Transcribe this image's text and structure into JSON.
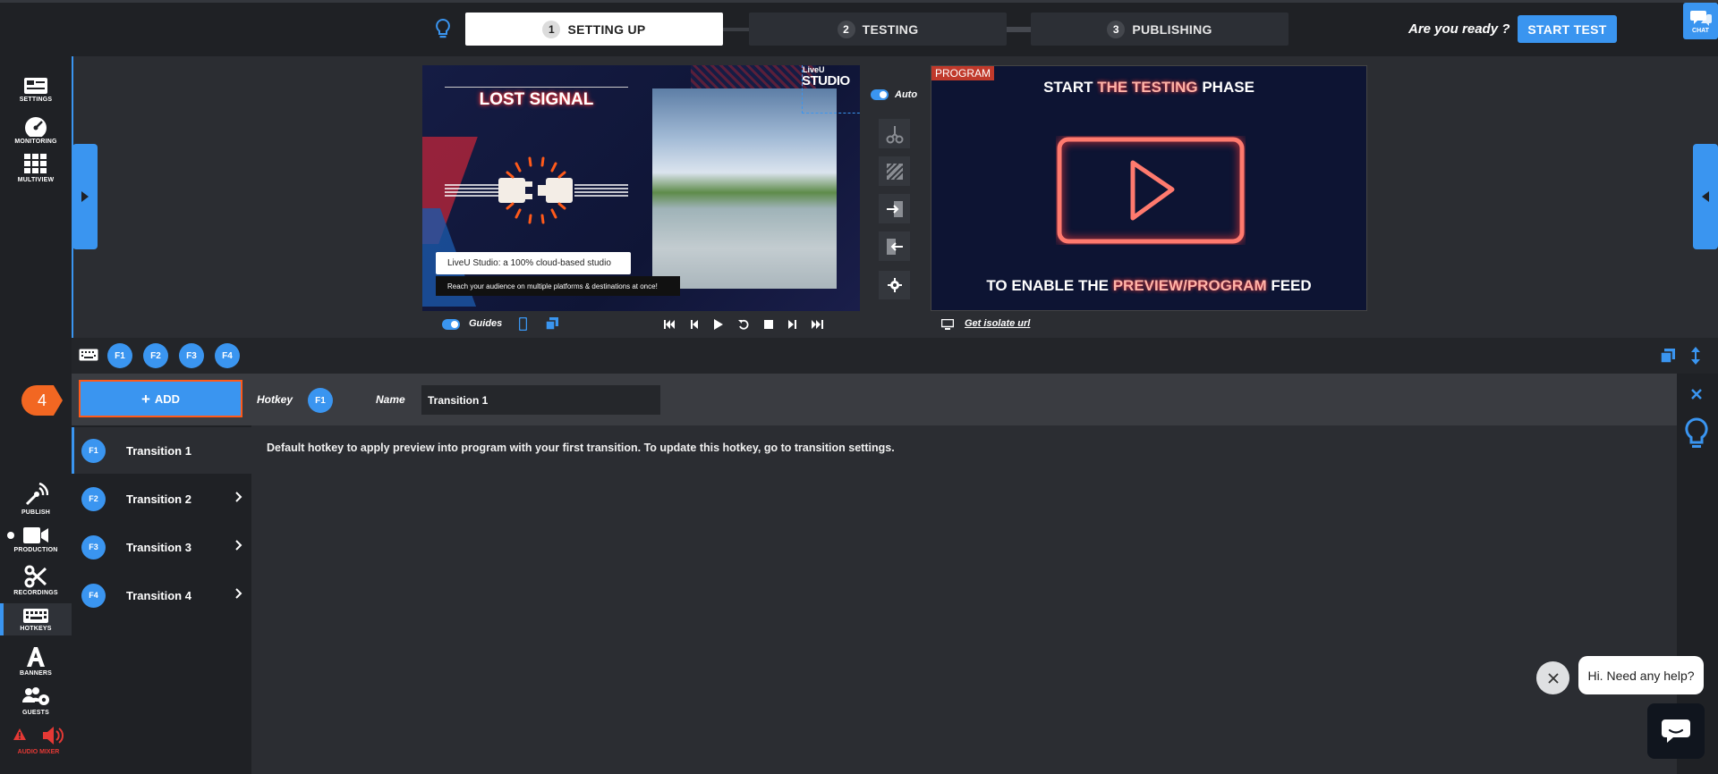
{
  "steps": [
    {
      "num": "1",
      "label": "SETTING UP"
    },
    {
      "num": "2",
      "label": "TESTING"
    },
    {
      "num": "3",
      "label": "PUBLISHING"
    }
  ],
  "topbar": {
    "ready_text": "Are you ready ?",
    "start_test": "START TEST",
    "chat": "CHAT"
  },
  "rail": {
    "settings": "SETTINGS",
    "monitoring": "MONITORING",
    "multiview": "MULTIVIEW",
    "publish": "PUBLISH",
    "production": "PRODUCTION",
    "recordings": "RECORDINGS",
    "hotkeys": "HOTKEYS",
    "banners": "BANNERS",
    "guests": "GUESTS",
    "audio_mixer": "AUDIO MIXER"
  },
  "preview": {
    "lost_signal": "LOST SIGNAL",
    "logo_small": "LiveU",
    "logo_big": "STUDIO",
    "caption1": "LiveU Studio: a 100% cloud-based studio",
    "caption2": "Reach your audience on multiple platforms & destinations at once!",
    "auto": "Auto",
    "guides": "Guides"
  },
  "program": {
    "tag": "PROGRAM",
    "line1_a": "START ",
    "line1_b": "THE TESTING",
    "line1_c": " PHASE",
    "line2_a": "TO ENABLE THE ",
    "line2_b": "PREVIEW/PROGRAM",
    "line2_c": " FEED",
    "isolate": "Get isolate url"
  },
  "hotkey_toolbar": {
    "keys": [
      "F1",
      "F2",
      "F3",
      "F4"
    ]
  },
  "hotkeys": {
    "add_label": "ADD",
    "badge": "4",
    "hotkey_label": "Hotkey",
    "hotkey_value": "F1",
    "name_label": "Name",
    "name_value": "Transition 1",
    "description": "Default hotkey to apply preview into program with your first transition. To update this hotkey, go to transition settings.",
    "items": [
      {
        "key": "F1",
        "label": "Transition 1"
      },
      {
        "key": "F2",
        "label": "Transition 2"
      },
      {
        "key": "F3",
        "label": "Transition 3"
      },
      {
        "key": "F4",
        "label": "Transition 4"
      }
    ]
  },
  "help": {
    "bubble": "Hi. Need any help?"
  },
  "colors": {
    "accent": "#3a95f0",
    "highlight": "#ff5a1a",
    "program_tag": "#c0392b"
  }
}
